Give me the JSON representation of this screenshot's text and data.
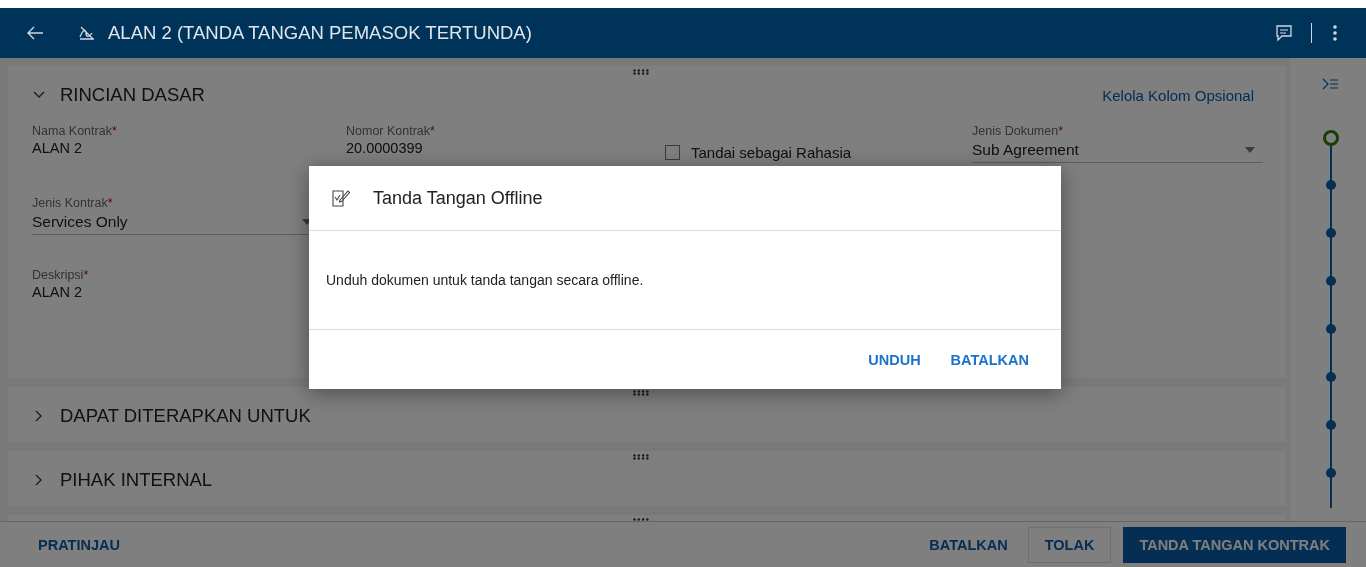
{
  "header": {
    "title": "ALAN 2 (TANDA TANGAN PEMASOK TERTUNDA)"
  },
  "sections": [
    {
      "kind": "panel",
      "title": "RINCIAN DASAR",
      "expanded": true,
      "link": "Kelola Kolom Opsional",
      "rows": [
        [
          {
            "kind": "text",
            "label": "Nama Kontrak",
            "required_mark": "*",
            "value": "ALAN 2"
          },
          {
            "kind": "text",
            "label": "Nomor Kontrak",
            "required_mark": "*",
            "value": "20.0000399"
          },
          {
            "kind": "checkbox",
            "label": "Tandai sebagai Rahasia",
            "checked": false
          },
          {
            "kind": "dropdown",
            "label": "Jenis Dokumen",
            "required_mark": "*",
            "value": "Sub Agreement"
          }
        ],
        [
          {
            "kind": "dropdown",
            "label": "Jenis Kontrak",
            "required_mark": "*",
            "value": "Services Only"
          }
        ],
        [
          {
            "kind": "text",
            "label": "Deskripsi",
            "required_mark": "*",
            "value": "ALAN 2"
          }
        ]
      ]
    },
    {
      "kind": "panel",
      "title": "DAPAT DITERAPKAN UNTUK",
      "expanded": false
    },
    {
      "kind": "panel",
      "title": "PIHAK INTERNAL",
      "expanded": false
    },
    {
      "kind": "stub"
    }
  ],
  "timeline": [
    {
      "current": true
    },
    {
      "current": false
    },
    {
      "current": false
    },
    {
      "current": false
    },
    {
      "current": false
    },
    {
      "current": false
    },
    {
      "current": false
    },
    {
      "current": false
    }
  ],
  "footer": {
    "preview": "PRATINJAU",
    "actions": [
      {
        "kind": "text",
        "label": "BATALKAN"
      },
      {
        "kind": "secondary",
        "label": "TOLAK"
      },
      {
        "kind": "primary",
        "label": "TANDA TANGAN KONTRAK"
      }
    ]
  },
  "dialog": {
    "title": "Tanda Tangan Offline",
    "message": "Unduh dokumen untuk tanda tangan secara offline.",
    "buttons": [
      "UNDUH",
      "BATALKAN"
    ]
  }
}
